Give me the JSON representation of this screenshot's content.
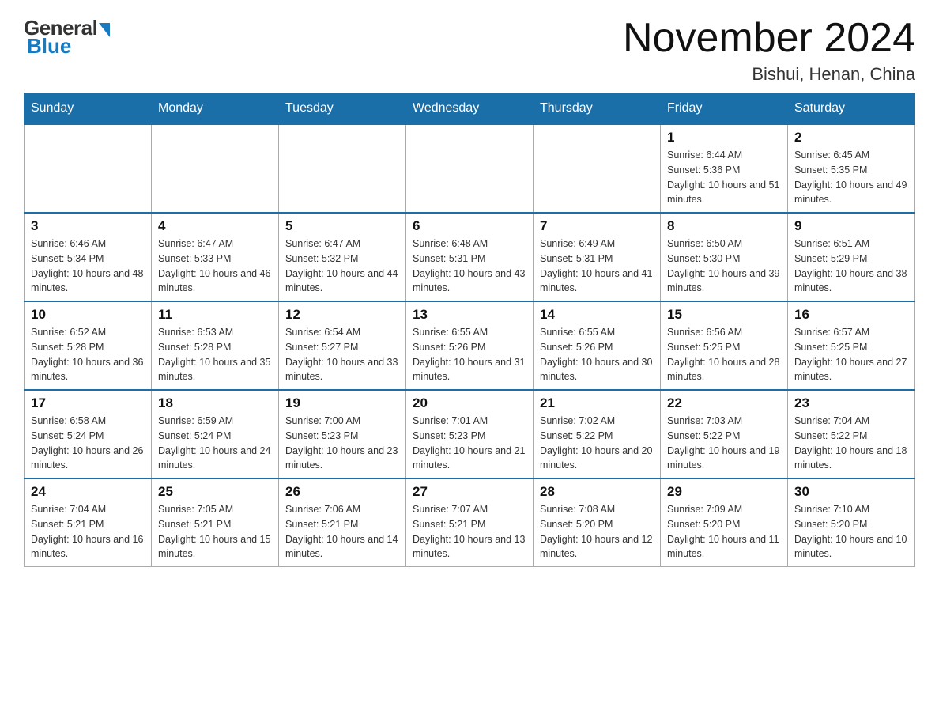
{
  "logo": {
    "general": "General",
    "blue": "Blue"
  },
  "header": {
    "month_year": "November 2024",
    "location": "Bishui, Henan, China"
  },
  "days_of_week": [
    "Sunday",
    "Monday",
    "Tuesday",
    "Wednesday",
    "Thursday",
    "Friday",
    "Saturday"
  ],
  "weeks": [
    [
      {
        "day": "",
        "info": ""
      },
      {
        "day": "",
        "info": ""
      },
      {
        "day": "",
        "info": ""
      },
      {
        "day": "",
        "info": ""
      },
      {
        "day": "",
        "info": ""
      },
      {
        "day": "1",
        "info": "Sunrise: 6:44 AM\nSunset: 5:36 PM\nDaylight: 10 hours and 51 minutes."
      },
      {
        "day": "2",
        "info": "Sunrise: 6:45 AM\nSunset: 5:35 PM\nDaylight: 10 hours and 49 minutes."
      }
    ],
    [
      {
        "day": "3",
        "info": "Sunrise: 6:46 AM\nSunset: 5:34 PM\nDaylight: 10 hours and 48 minutes."
      },
      {
        "day": "4",
        "info": "Sunrise: 6:47 AM\nSunset: 5:33 PM\nDaylight: 10 hours and 46 minutes."
      },
      {
        "day": "5",
        "info": "Sunrise: 6:47 AM\nSunset: 5:32 PM\nDaylight: 10 hours and 44 minutes."
      },
      {
        "day": "6",
        "info": "Sunrise: 6:48 AM\nSunset: 5:31 PM\nDaylight: 10 hours and 43 minutes."
      },
      {
        "day": "7",
        "info": "Sunrise: 6:49 AM\nSunset: 5:31 PM\nDaylight: 10 hours and 41 minutes."
      },
      {
        "day": "8",
        "info": "Sunrise: 6:50 AM\nSunset: 5:30 PM\nDaylight: 10 hours and 39 minutes."
      },
      {
        "day": "9",
        "info": "Sunrise: 6:51 AM\nSunset: 5:29 PM\nDaylight: 10 hours and 38 minutes."
      }
    ],
    [
      {
        "day": "10",
        "info": "Sunrise: 6:52 AM\nSunset: 5:28 PM\nDaylight: 10 hours and 36 minutes."
      },
      {
        "day": "11",
        "info": "Sunrise: 6:53 AM\nSunset: 5:28 PM\nDaylight: 10 hours and 35 minutes."
      },
      {
        "day": "12",
        "info": "Sunrise: 6:54 AM\nSunset: 5:27 PM\nDaylight: 10 hours and 33 minutes."
      },
      {
        "day": "13",
        "info": "Sunrise: 6:55 AM\nSunset: 5:26 PM\nDaylight: 10 hours and 31 minutes."
      },
      {
        "day": "14",
        "info": "Sunrise: 6:55 AM\nSunset: 5:26 PM\nDaylight: 10 hours and 30 minutes."
      },
      {
        "day": "15",
        "info": "Sunrise: 6:56 AM\nSunset: 5:25 PM\nDaylight: 10 hours and 28 minutes."
      },
      {
        "day": "16",
        "info": "Sunrise: 6:57 AM\nSunset: 5:25 PM\nDaylight: 10 hours and 27 minutes."
      }
    ],
    [
      {
        "day": "17",
        "info": "Sunrise: 6:58 AM\nSunset: 5:24 PM\nDaylight: 10 hours and 26 minutes."
      },
      {
        "day": "18",
        "info": "Sunrise: 6:59 AM\nSunset: 5:24 PM\nDaylight: 10 hours and 24 minutes."
      },
      {
        "day": "19",
        "info": "Sunrise: 7:00 AM\nSunset: 5:23 PM\nDaylight: 10 hours and 23 minutes."
      },
      {
        "day": "20",
        "info": "Sunrise: 7:01 AM\nSunset: 5:23 PM\nDaylight: 10 hours and 21 minutes."
      },
      {
        "day": "21",
        "info": "Sunrise: 7:02 AM\nSunset: 5:22 PM\nDaylight: 10 hours and 20 minutes."
      },
      {
        "day": "22",
        "info": "Sunrise: 7:03 AM\nSunset: 5:22 PM\nDaylight: 10 hours and 19 minutes."
      },
      {
        "day": "23",
        "info": "Sunrise: 7:04 AM\nSunset: 5:22 PM\nDaylight: 10 hours and 18 minutes."
      }
    ],
    [
      {
        "day": "24",
        "info": "Sunrise: 7:04 AM\nSunset: 5:21 PM\nDaylight: 10 hours and 16 minutes."
      },
      {
        "day": "25",
        "info": "Sunrise: 7:05 AM\nSunset: 5:21 PM\nDaylight: 10 hours and 15 minutes."
      },
      {
        "day": "26",
        "info": "Sunrise: 7:06 AM\nSunset: 5:21 PM\nDaylight: 10 hours and 14 minutes."
      },
      {
        "day": "27",
        "info": "Sunrise: 7:07 AM\nSunset: 5:21 PM\nDaylight: 10 hours and 13 minutes."
      },
      {
        "day": "28",
        "info": "Sunrise: 7:08 AM\nSunset: 5:20 PM\nDaylight: 10 hours and 12 minutes."
      },
      {
        "day": "29",
        "info": "Sunrise: 7:09 AM\nSunset: 5:20 PM\nDaylight: 10 hours and 11 minutes."
      },
      {
        "day": "30",
        "info": "Sunrise: 7:10 AM\nSunset: 5:20 PM\nDaylight: 10 hours and 10 minutes."
      }
    ]
  ]
}
